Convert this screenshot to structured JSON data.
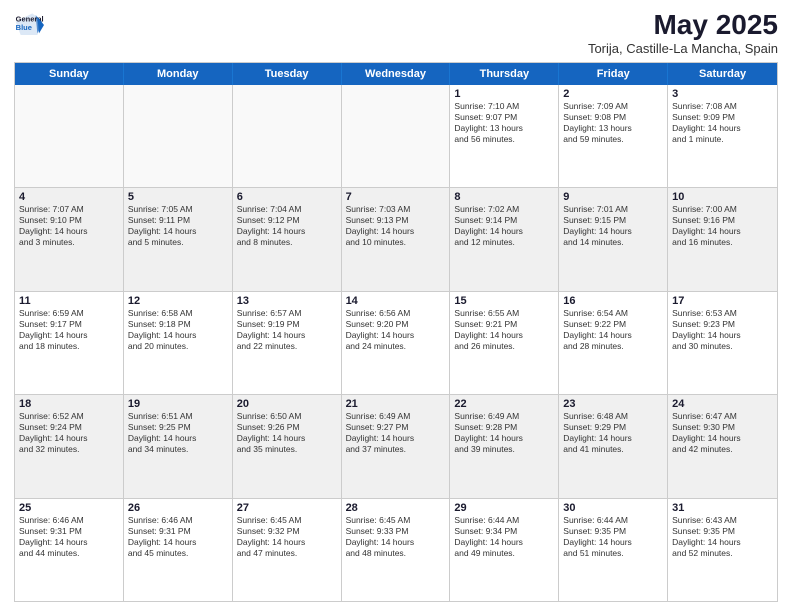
{
  "logo": {
    "line1": "General",
    "line2": "Blue"
  },
  "header": {
    "title": "May 2025",
    "location": "Torija, Castille-La Mancha, Spain"
  },
  "weekdays": [
    "Sunday",
    "Monday",
    "Tuesday",
    "Wednesday",
    "Thursday",
    "Friday",
    "Saturday"
  ],
  "rows": [
    {
      "alt": false,
      "cells": [
        {
          "day": "",
          "info": ""
        },
        {
          "day": "",
          "info": ""
        },
        {
          "day": "",
          "info": ""
        },
        {
          "day": "",
          "info": ""
        },
        {
          "day": "1",
          "info": "Sunrise: 7:10 AM\nSunset: 9:07 PM\nDaylight: 13 hours\nand 56 minutes."
        },
        {
          "day": "2",
          "info": "Sunrise: 7:09 AM\nSunset: 9:08 PM\nDaylight: 13 hours\nand 59 minutes."
        },
        {
          "day": "3",
          "info": "Sunrise: 7:08 AM\nSunset: 9:09 PM\nDaylight: 14 hours\nand 1 minute."
        }
      ]
    },
    {
      "alt": true,
      "cells": [
        {
          "day": "4",
          "info": "Sunrise: 7:07 AM\nSunset: 9:10 PM\nDaylight: 14 hours\nand 3 minutes."
        },
        {
          "day": "5",
          "info": "Sunrise: 7:05 AM\nSunset: 9:11 PM\nDaylight: 14 hours\nand 5 minutes."
        },
        {
          "day": "6",
          "info": "Sunrise: 7:04 AM\nSunset: 9:12 PM\nDaylight: 14 hours\nand 8 minutes."
        },
        {
          "day": "7",
          "info": "Sunrise: 7:03 AM\nSunset: 9:13 PM\nDaylight: 14 hours\nand 10 minutes."
        },
        {
          "day": "8",
          "info": "Sunrise: 7:02 AM\nSunset: 9:14 PM\nDaylight: 14 hours\nand 12 minutes."
        },
        {
          "day": "9",
          "info": "Sunrise: 7:01 AM\nSunset: 9:15 PM\nDaylight: 14 hours\nand 14 minutes."
        },
        {
          "day": "10",
          "info": "Sunrise: 7:00 AM\nSunset: 9:16 PM\nDaylight: 14 hours\nand 16 minutes."
        }
      ]
    },
    {
      "alt": false,
      "cells": [
        {
          "day": "11",
          "info": "Sunrise: 6:59 AM\nSunset: 9:17 PM\nDaylight: 14 hours\nand 18 minutes."
        },
        {
          "day": "12",
          "info": "Sunrise: 6:58 AM\nSunset: 9:18 PM\nDaylight: 14 hours\nand 20 minutes."
        },
        {
          "day": "13",
          "info": "Sunrise: 6:57 AM\nSunset: 9:19 PM\nDaylight: 14 hours\nand 22 minutes."
        },
        {
          "day": "14",
          "info": "Sunrise: 6:56 AM\nSunset: 9:20 PM\nDaylight: 14 hours\nand 24 minutes."
        },
        {
          "day": "15",
          "info": "Sunrise: 6:55 AM\nSunset: 9:21 PM\nDaylight: 14 hours\nand 26 minutes."
        },
        {
          "day": "16",
          "info": "Sunrise: 6:54 AM\nSunset: 9:22 PM\nDaylight: 14 hours\nand 28 minutes."
        },
        {
          "day": "17",
          "info": "Sunrise: 6:53 AM\nSunset: 9:23 PM\nDaylight: 14 hours\nand 30 minutes."
        }
      ]
    },
    {
      "alt": true,
      "cells": [
        {
          "day": "18",
          "info": "Sunrise: 6:52 AM\nSunset: 9:24 PM\nDaylight: 14 hours\nand 32 minutes."
        },
        {
          "day": "19",
          "info": "Sunrise: 6:51 AM\nSunset: 9:25 PM\nDaylight: 14 hours\nand 34 minutes."
        },
        {
          "day": "20",
          "info": "Sunrise: 6:50 AM\nSunset: 9:26 PM\nDaylight: 14 hours\nand 35 minutes."
        },
        {
          "day": "21",
          "info": "Sunrise: 6:49 AM\nSunset: 9:27 PM\nDaylight: 14 hours\nand 37 minutes."
        },
        {
          "day": "22",
          "info": "Sunrise: 6:49 AM\nSunset: 9:28 PM\nDaylight: 14 hours\nand 39 minutes."
        },
        {
          "day": "23",
          "info": "Sunrise: 6:48 AM\nSunset: 9:29 PM\nDaylight: 14 hours\nand 41 minutes."
        },
        {
          "day": "24",
          "info": "Sunrise: 6:47 AM\nSunset: 9:30 PM\nDaylight: 14 hours\nand 42 minutes."
        }
      ]
    },
    {
      "alt": false,
      "cells": [
        {
          "day": "25",
          "info": "Sunrise: 6:46 AM\nSunset: 9:31 PM\nDaylight: 14 hours\nand 44 minutes."
        },
        {
          "day": "26",
          "info": "Sunrise: 6:46 AM\nSunset: 9:31 PM\nDaylight: 14 hours\nand 45 minutes."
        },
        {
          "day": "27",
          "info": "Sunrise: 6:45 AM\nSunset: 9:32 PM\nDaylight: 14 hours\nand 47 minutes."
        },
        {
          "day": "28",
          "info": "Sunrise: 6:45 AM\nSunset: 9:33 PM\nDaylight: 14 hours\nand 48 minutes."
        },
        {
          "day": "29",
          "info": "Sunrise: 6:44 AM\nSunset: 9:34 PM\nDaylight: 14 hours\nand 49 minutes."
        },
        {
          "day": "30",
          "info": "Sunrise: 6:44 AM\nSunset: 9:35 PM\nDaylight: 14 hours\nand 51 minutes."
        },
        {
          "day": "31",
          "info": "Sunrise: 6:43 AM\nSunset: 9:35 PM\nDaylight: 14 hours\nand 52 minutes."
        }
      ]
    }
  ]
}
